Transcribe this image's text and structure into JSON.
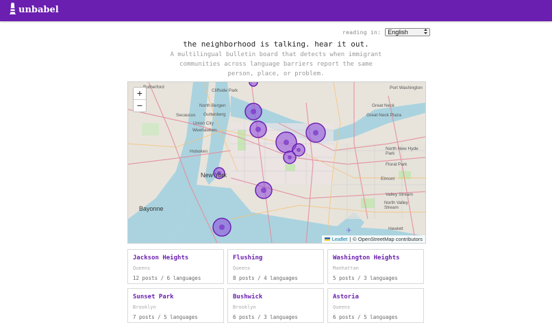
{
  "app": {
    "name": "unbabel",
    "logo_icon": "lighthouse-icon",
    "accent": "#6a1fb0"
  },
  "language": {
    "label": "reading in:",
    "selected": "English"
  },
  "hero": {
    "tagline": "the neighborhood is talking. hear it out.",
    "description": "A multilingual bulletin board that detects when immigrant communities across language barriers report the same person, place, or problem."
  },
  "map": {
    "zoom_in": "+",
    "zoom_out": "−",
    "attribution_leaflet": "Leaflet",
    "attribution_sep": "|",
    "attribution_osm": "© OpenStreetMap contributors",
    "labels": [
      "Rutherford",
      "Cliffside Park",
      "Port Washington",
      "North Bergen",
      "Secaucus",
      "Union City",
      "Weehawken",
      "Guttenberg",
      "Great Neck",
      "Great Neck Plaza",
      "Hoboken",
      "New York",
      "North New Hyde Park",
      "Floral Park",
      "Elmont",
      "Bayonne",
      "Valley Stream",
      "North Valley Stream",
      "Hewlett"
    ]
  },
  "neighborhoods": [
    {
      "name": "Jackson Heights",
      "borough": "Queens",
      "stats": "12 posts / 6 languages"
    },
    {
      "name": "Flushing",
      "borough": "Queens",
      "stats": "8 posts / 4 languages"
    },
    {
      "name": "Washington Heights",
      "borough": "Manhattan",
      "stats": "5 posts / 3 languages"
    },
    {
      "name": "Sunset Park",
      "borough": "Brooklyn",
      "stats": "7 posts / 5 languages"
    },
    {
      "name": "Bushwick",
      "borough": "Brooklyn",
      "stats": "6 posts / 3 languages"
    },
    {
      "name": "Astoria",
      "borough": "Queens",
      "stats": "6 posts / 5 languages"
    }
  ]
}
